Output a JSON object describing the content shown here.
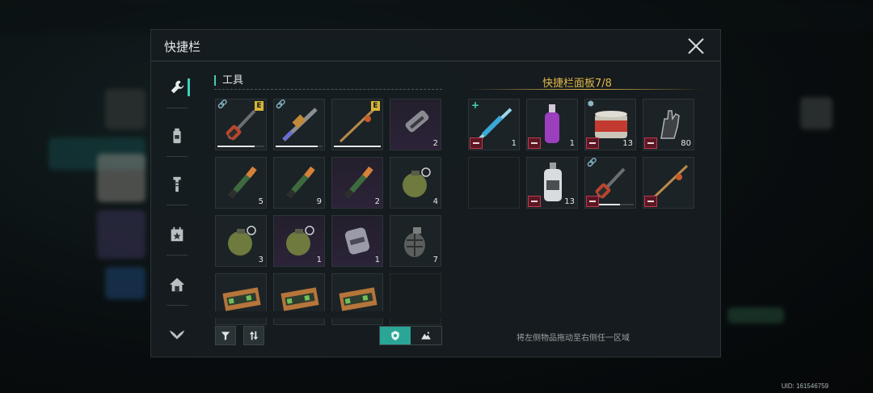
{
  "panel": {
    "title": "快捷栏"
  },
  "inventory": {
    "heading": "工具",
    "items": [
      {
        "icon": "pickaxe-icon",
        "qty": "",
        "badge": "E",
        "linked": true,
        "durability": 0.8,
        "rarity": "common"
      },
      {
        "icon": "drill-icon",
        "qty": "",
        "badge": "",
        "linked": true,
        "durability": 0.9,
        "rarity": "common"
      },
      {
        "icon": "fishing-rod-icon",
        "qty": "",
        "badge": "E",
        "linked": false,
        "durability": 1.0,
        "rarity": "common"
      },
      {
        "icon": "flashlight-icon",
        "qty": "2",
        "badge": "",
        "linked": false,
        "durability": null,
        "rarity": "purple"
      },
      {
        "icon": "flare-icon",
        "qty": "5",
        "badge": "",
        "linked": false,
        "durability": null,
        "rarity": "common"
      },
      {
        "icon": "flare-icon",
        "qty": "9",
        "badge": "",
        "linked": false,
        "durability": null,
        "rarity": "common"
      },
      {
        "icon": "flare-icon",
        "qty": "2",
        "badge": "",
        "linked": false,
        "durability": null,
        "rarity": "purple"
      },
      {
        "icon": "grenade-icon",
        "qty": "4",
        "badge": "",
        "linked": false,
        "durability": null,
        "rarity": "common"
      },
      {
        "icon": "grenade-icon",
        "qty": "3",
        "badge": "",
        "linked": false,
        "durability": null,
        "rarity": "common"
      },
      {
        "icon": "grenade-icon",
        "qty": "1",
        "badge": "",
        "linked": false,
        "durability": null,
        "rarity": "purple"
      },
      {
        "icon": "canister-icon",
        "qty": "1",
        "badge": "",
        "linked": false,
        "durability": null,
        "rarity": "purple"
      },
      {
        "icon": "frag-grenade-icon",
        "qty": "7",
        "badge": "",
        "linked": false,
        "durability": null,
        "rarity": "common"
      },
      {
        "icon": "ammo-box-icon",
        "qty": "",
        "badge": "",
        "linked": false,
        "durability": null,
        "rarity": "common"
      },
      {
        "icon": "ammo-box-icon",
        "qty": "",
        "badge": "",
        "linked": false,
        "durability": null,
        "rarity": "common"
      },
      {
        "icon": "ammo-box-icon",
        "qty": "",
        "badge": "",
        "linked": false,
        "durability": null,
        "rarity": "common"
      },
      {
        "icon": "",
        "qty": "",
        "badge": "",
        "linked": false,
        "durability": null,
        "rarity": "empty"
      }
    ]
  },
  "quickbar": {
    "title": "快捷栏面板7/8",
    "hint": "将左侧物品拖动至右侧任一区域",
    "slots": [
      {
        "icon": "syringe-icon",
        "qty": "1",
        "mark": "plus",
        "durability": null
      },
      {
        "icon": "purple-bottle-icon",
        "qty": "1",
        "mark": "",
        "durability": null
      },
      {
        "icon": "canned-food-icon",
        "qty": "13",
        "mark": "shield",
        "durability": null
      },
      {
        "icon": "robot-hand-icon",
        "qty": "80",
        "mark": "",
        "durability": null
      },
      {
        "icon": "",
        "qty": "",
        "mark": "",
        "durability": null,
        "empty": true
      },
      {
        "icon": "spray-bottle-icon",
        "qty": "13",
        "mark": "",
        "durability": null
      },
      {
        "icon": "pickaxe-icon",
        "qty": "",
        "mark": "link",
        "durability": 0.7
      },
      {
        "icon": "fishing-rod-icon",
        "qty": "",
        "mark": "",
        "durability": null
      }
    ]
  },
  "uid": "UID: 161546759"
}
